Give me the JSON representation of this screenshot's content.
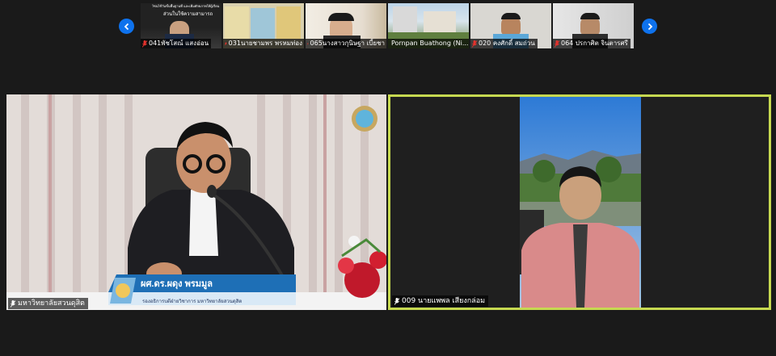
{
  "nav": {
    "prev_icon": "chevron-left-icon",
    "next_icon": "chevron-right-icon"
  },
  "thumbnail_strip": [
    {
      "label": "041พัชโสณ์ แสงอ่อน",
      "slide_caption_1": "ไซนไซ้วันขั้นพื้นฐานที่ และเพิ่มศักยภาพให้ผู้เรียน",
      "slide_caption_2": "ส่วนในใช้ความสามารถ"
    },
    {
      "label": "031นายชามพร  พรหมท่อง"
    },
    {
      "label": "065นางสาวกุนิษฐา  เบี้ยชา"
    },
    {
      "label": "Pornpan Buathong (Ni..."
    },
    {
      "label": "020 คงศักดิ์  สมถ่วน"
    },
    {
      "label": "064 ปรกาศิต จินตารศรี"
    }
  ],
  "main_left": {
    "name_tag": "มหาวิทยาลัยสวนดุสิต",
    "lower_third_name": "ผศ.ดร.ผดุง พรมมูล",
    "lower_third_title": "รองอธิการบดีฝ่ายวิชาการ มหาวิทยาลัยสวนดุสิต"
  },
  "main_right": {
    "name_tag": "009 นายแพพล เสียงกล่อม",
    "active_speaker_color": "#c6d950"
  },
  "colors": {
    "accent": "#0e72ed",
    "muted_mic": "#e5322d"
  }
}
